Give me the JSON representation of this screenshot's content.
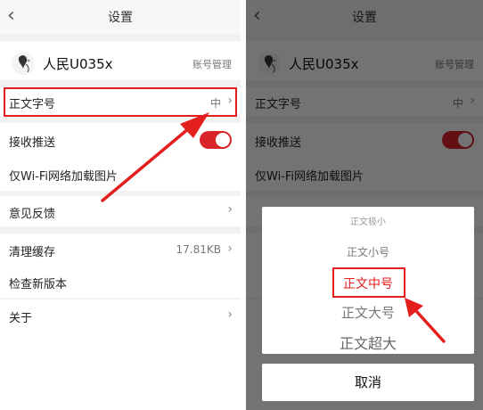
{
  "settings_title": "设置",
  "user": {
    "name": "人民U035x",
    "account_link": "账号管理"
  },
  "font_size": {
    "label": "正文字号",
    "value": "中"
  },
  "push": {
    "label": "接收推送",
    "enabled": true
  },
  "wifi_images": {
    "label": "仅Wi-Fi网络加载图片"
  },
  "feedback": {
    "label": "意见反馈"
  },
  "cache": {
    "label": "清理缓存",
    "value": "17.81KB"
  },
  "update": {
    "label": "检查新版本"
  },
  "about": {
    "label": "关于"
  },
  "font_dialog": {
    "options": [
      "正文极小",
      "正文小号",
      "正文中号",
      "正文大号",
      "正文超大"
    ],
    "selected": "正文中号",
    "cancel": "取消"
  },
  "colors": {
    "accent": "#d9252a",
    "highlight": "#e41d1d"
  }
}
